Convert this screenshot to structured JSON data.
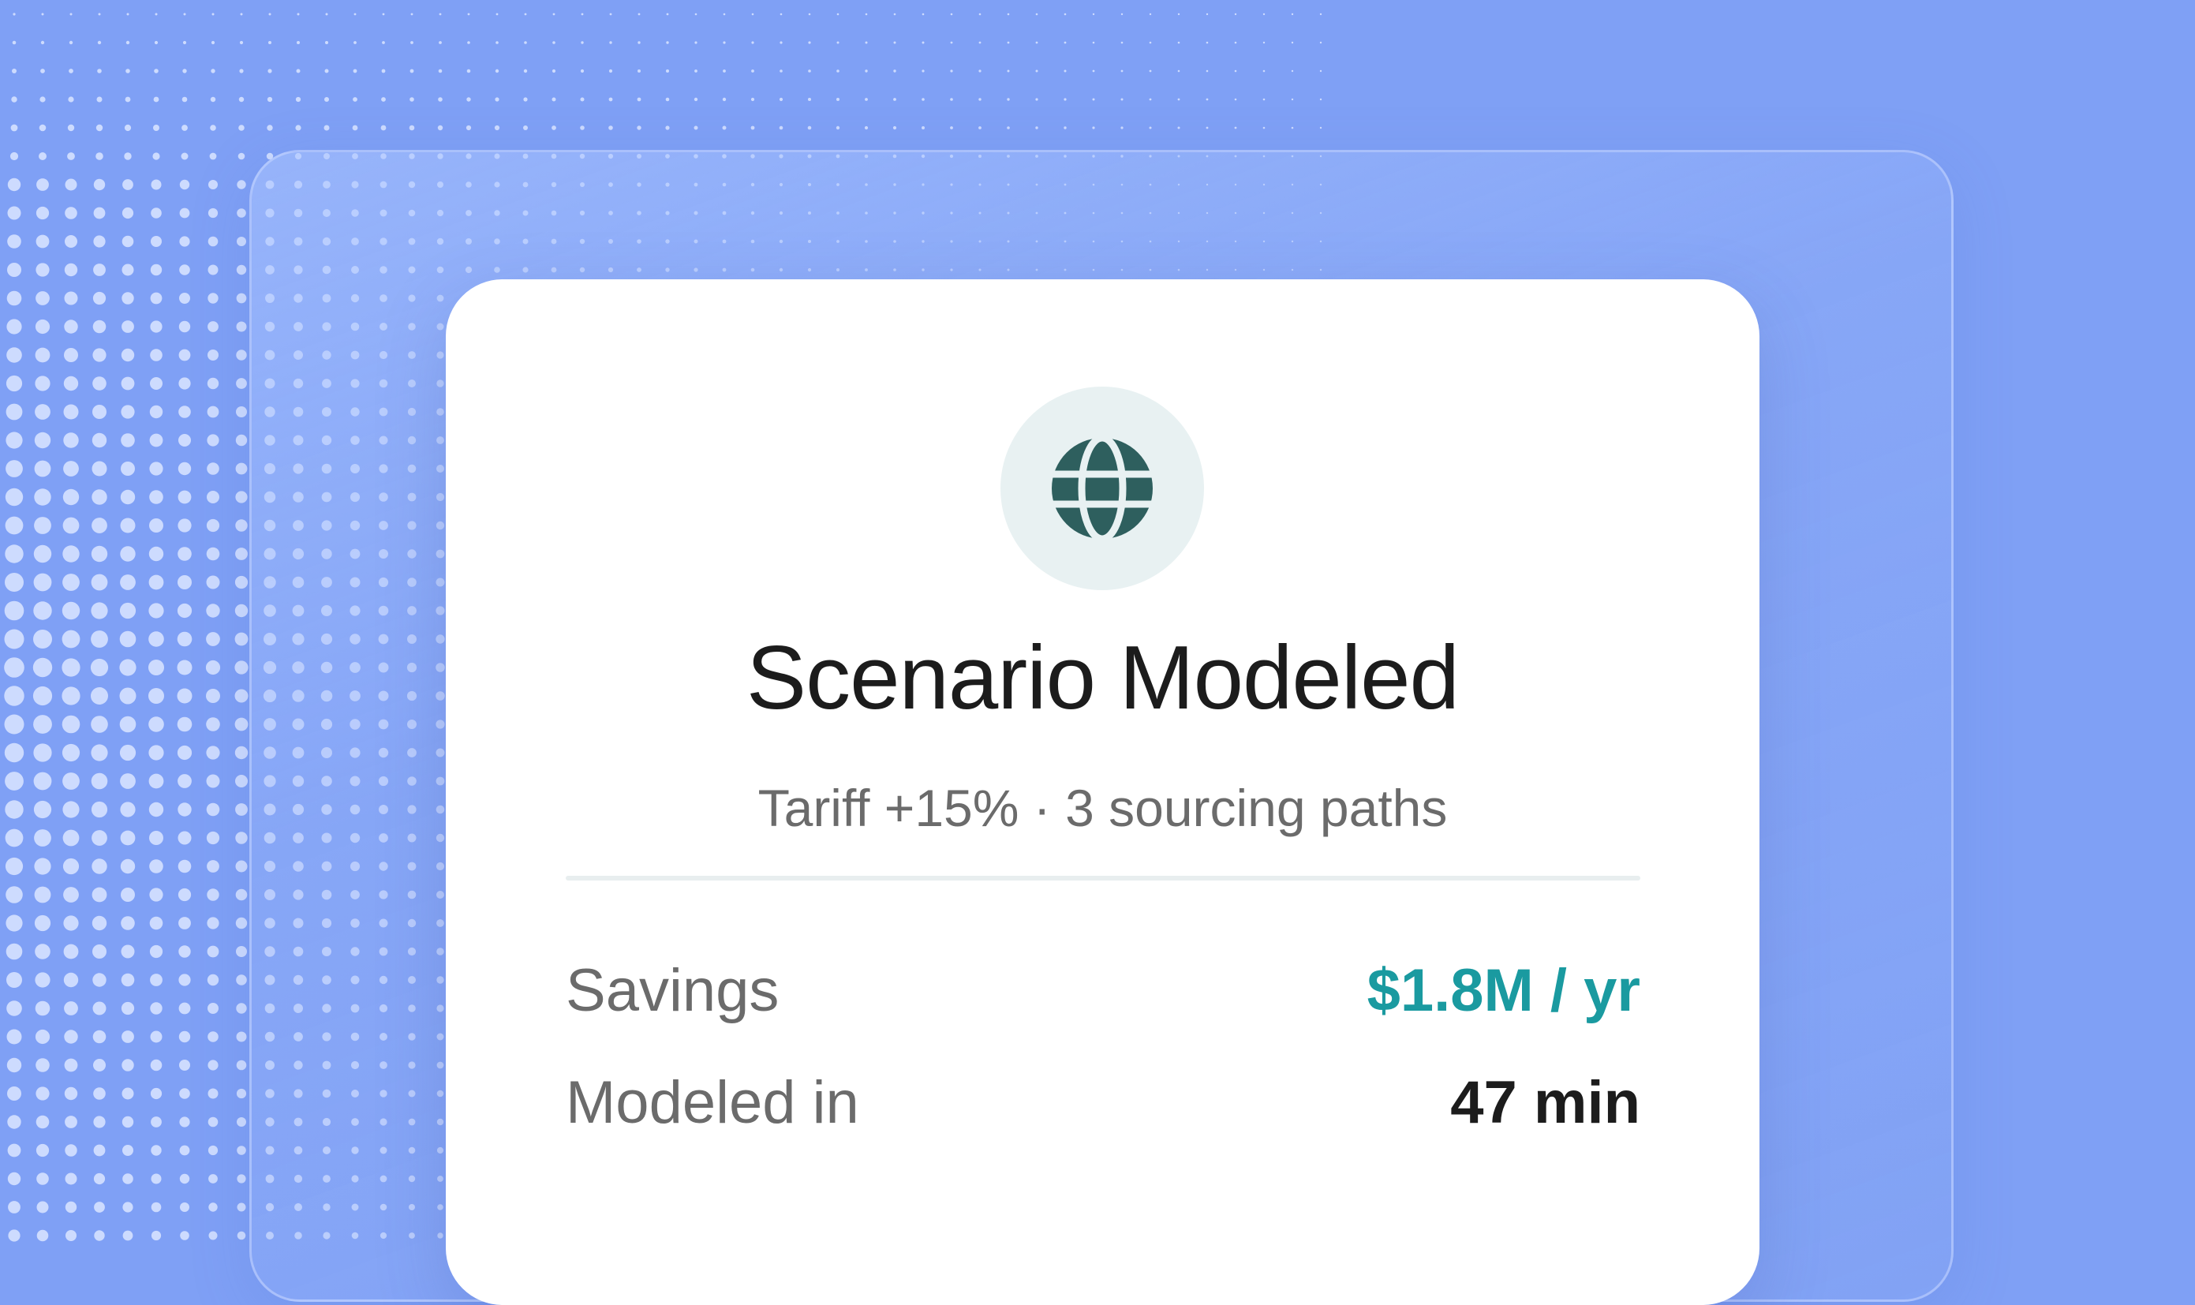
{
  "card": {
    "title": "Scenario Modeled",
    "subtitle": "Tariff +15% · 3 sourcing paths",
    "icon": "globe-icon",
    "rows": [
      {
        "label": "Savings",
        "value": "$1.8M / yr"
      },
      {
        "label": "Modeled in",
        "value": "47 min"
      }
    ]
  },
  "colors": {
    "background": "#7fa0f5",
    "accent": "#1a9aa0",
    "icon": "#2e5f5e",
    "icon_bg": "#e8f1f2",
    "dots": "#dbe5ff"
  }
}
